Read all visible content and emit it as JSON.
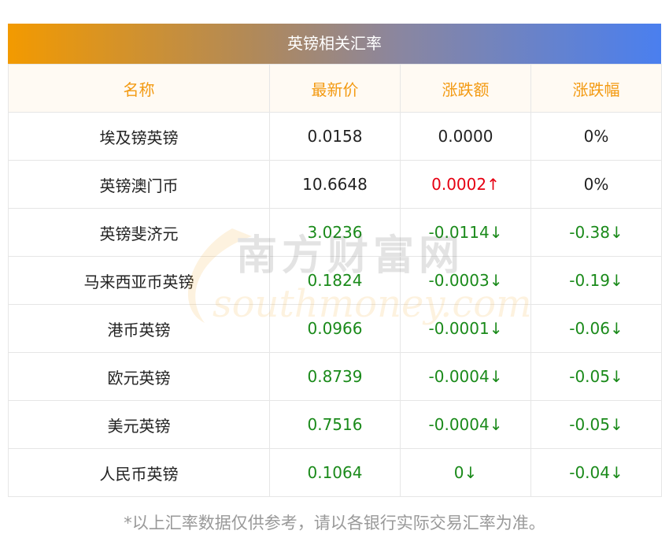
{
  "title": "英镑相关汇率",
  "headers": [
    "名称",
    "最新价",
    "涨跌额",
    "涨跌幅"
  ],
  "rows": [
    {
      "name": "埃及镑英镑",
      "price": "0.0158",
      "change": "0.0000",
      "pct": "0%",
      "price_dir": "flat",
      "change_dir": "flat",
      "pct_dir": "flat"
    },
    {
      "name": "英镑澳门币",
      "price": "10.6648",
      "change": "0.0002↑",
      "pct": "0%",
      "price_dir": "flat",
      "change_dir": "up",
      "pct_dir": "flat"
    },
    {
      "name": "英镑斐济元",
      "price": "3.0236",
      "change": "-0.0114↓",
      "pct": "-0.38↓",
      "price_dir": "down",
      "change_dir": "down",
      "pct_dir": "down"
    },
    {
      "name": "马来西亚币英镑",
      "price": "0.1824",
      "change": "-0.0003↓",
      "pct": "-0.19↓",
      "price_dir": "down",
      "change_dir": "down",
      "pct_dir": "down"
    },
    {
      "name": "港币英镑",
      "price": "0.0966",
      "change": "-0.0001↓",
      "pct": "-0.06↓",
      "price_dir": "down",
      "change_dir": "down",
      "pct_dir": "down"
    },
    {
      "name": "欧元英镑",
      "price": "0.8739",
      "change": "-0.0004↓",
      "pct": "-0.05↓",
      "price_dir": "down",
      "change_dir": "down",
      "pct_dir": "down"
    },
    {
      "name": "美元英镑",
      "price": "0.7516",
      "change": "-0.0004↓",
      "pct": "-0.05↓",
      "price_dir": "down",
      "change_dir": "down",
      "pct_dir": "down"
    },
    {
      "name": "人民币英镑",
      "price": "0.1064",
      "change": "0↓",
      "pct": "-0.04↓",
      "price_dir": "down",
      "change_dir": "down",
      "pct_dir": "down"
    }
  ],
  "watermark": {
    "cn": "南方财富网",
    "en": "southmoney.com"
  },
  "footnote": "*以上汇率数据仅供参考，请以各银行实际交易汇率为准。",
  "colors": {
    "up": "#e60012",
    "down": "#1a8a1a",
    "header_text": "#f39a12"
  }
}
